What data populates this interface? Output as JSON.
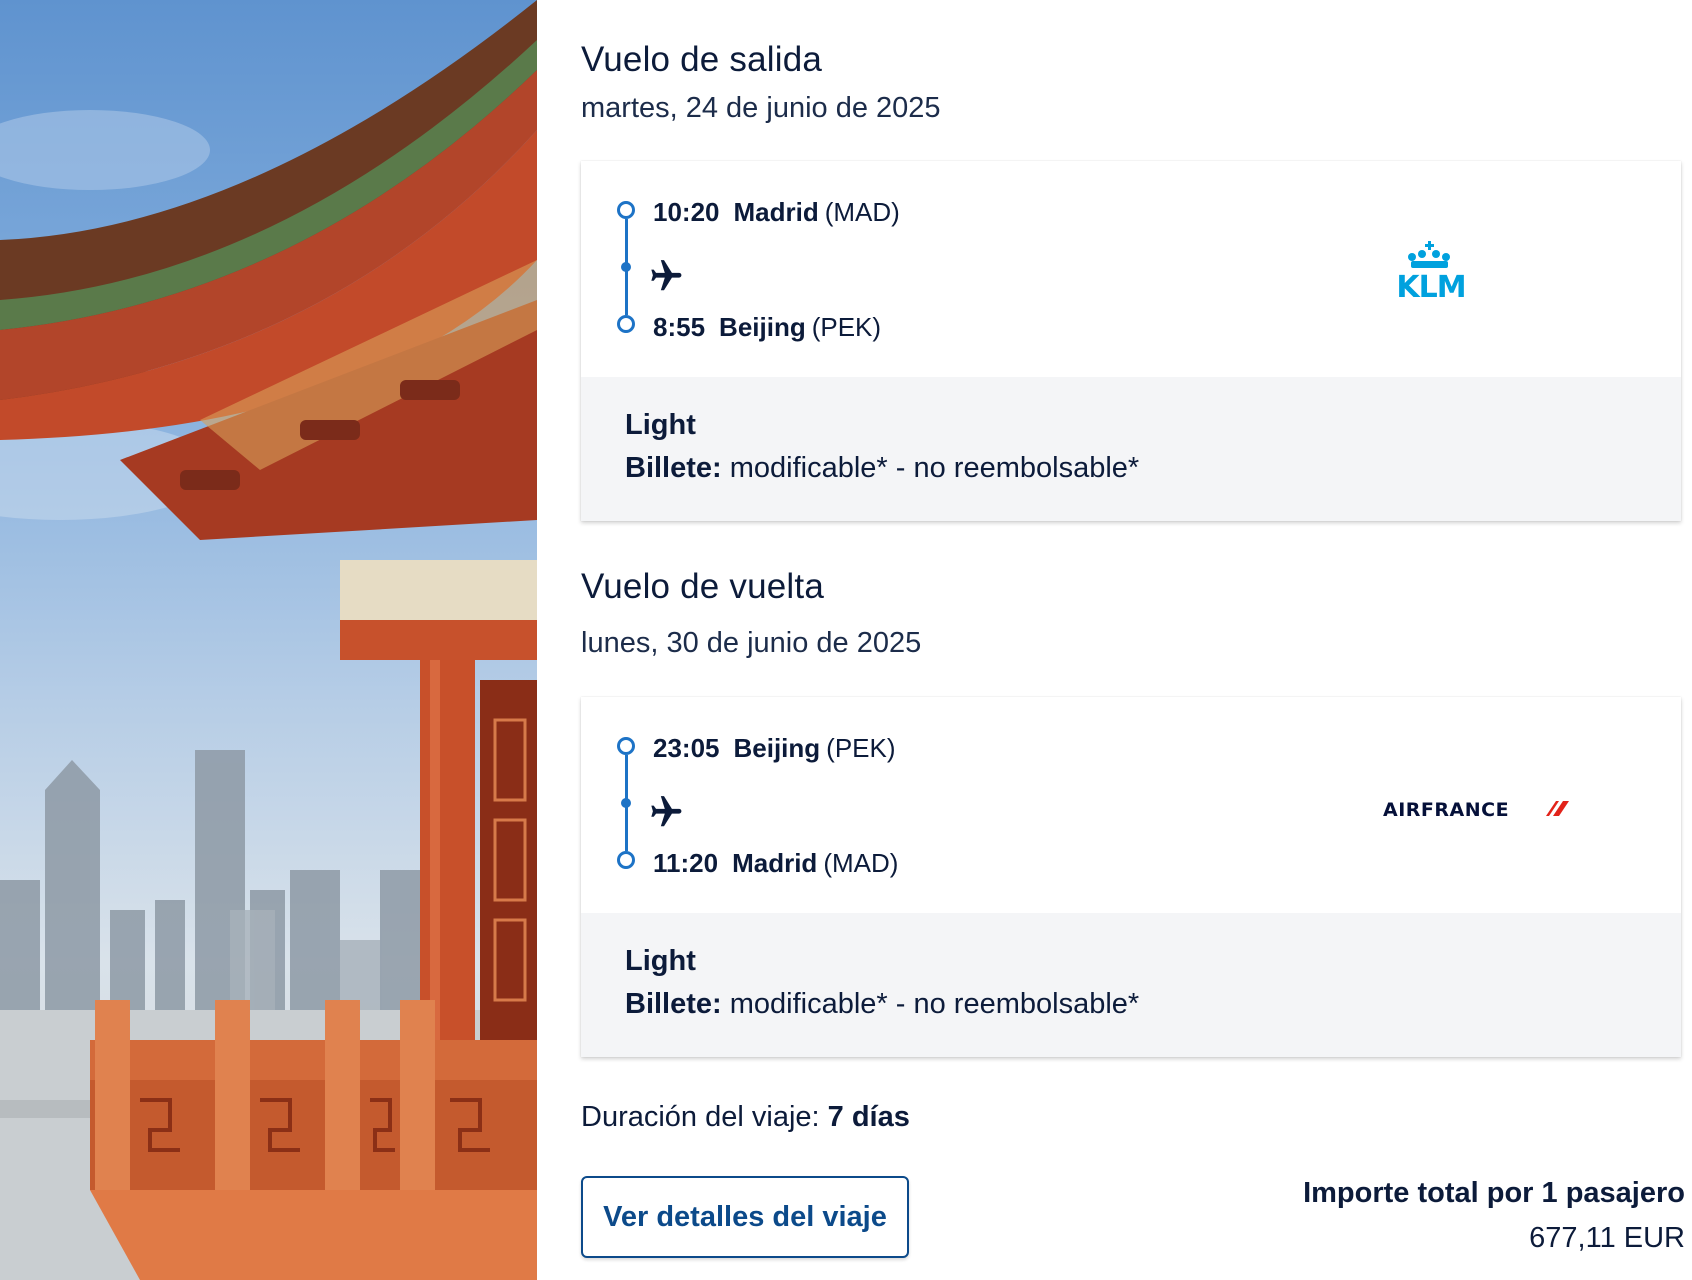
{
  "outbound": {
    "title": "Vuelo de salida",
    "date": "martes, 24 de junio de 2025",
    "departure": {
      "time": "10:20",
      "city": "Madrid",
      "code": "(MAD)"
    },
    "arrival": {
      "time": "8:55",
      "city": "Beijing",
      "code": "(PEK)"
    },
    "airline_logo": "KLM",
    "fare": {
      "name": "Light",
      "ticket_label": "Billete:",
      "ticket_conditions": "modificable* - no reembolsable*"
    }
  },
  "return": {
    "title": "Vuelo de vuelta",
    "date": "lunes, 30 de junio de 2025",
    "departure": {
      "time": "23:05",
      "city": "Beijing",
      "code": "(PEK)"
    },
    "arrival": {
      "time": "11:20",
      "city": "Madrid",
      "code": "(MAD)"
    },
    "airline_logo": "AIRFRANCE",
    "fare": {
      "name": "Light",
      "ticket_label": "Billete:",
      "ticket_conditions": "modificable* - no reembolsable*"
    }
  },
  "trip": {
    "duration_label": "Duración del viaje:",
    "duration_value": "7 días",
    "details_button": "Ver detalles del viaje",
    "total_label": "Importe total por 1 pasajero",
    "total_price": "677,11 EUR"
  },
  "colors": {
    "primary_text": "#0c1b3a",
    "accent_blue": "#1d73c6",
    "klm_blue": "#00a1de",
    "airfrance_navy": "#051039",
    "airfrance_red": "#e2231a",
    "button_border": "#0c4a8a",
    "fare_background": "#f4f5f7"
  },
  "icons": [
    "plane-icon",
    "timeline-origin-icon",
    "timeline-destination-icon"
  ]
}
